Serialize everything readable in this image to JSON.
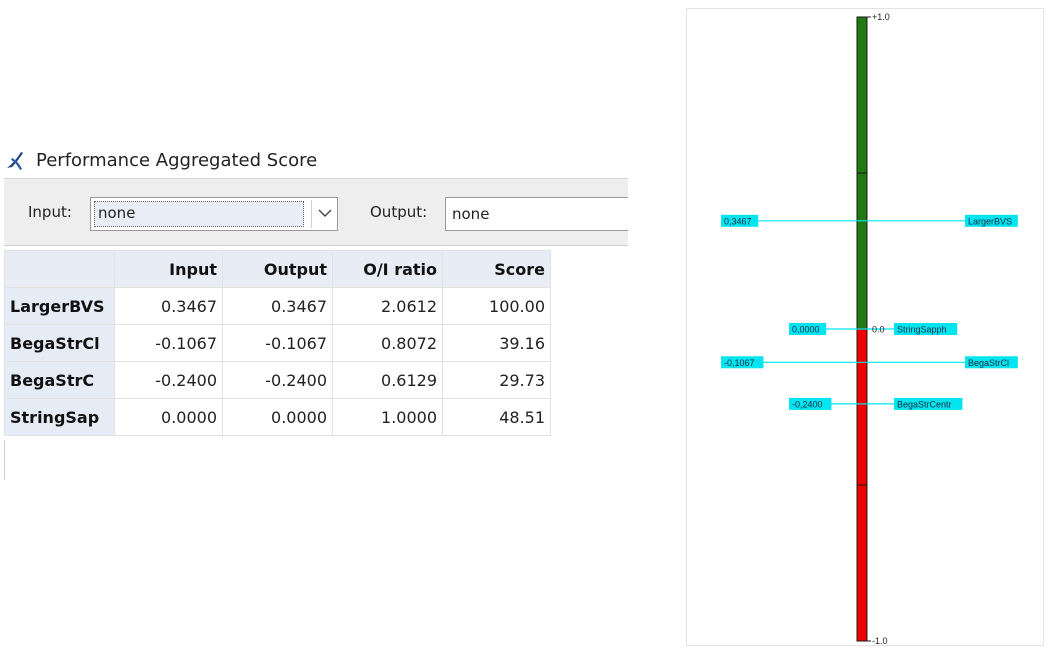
{
  "window": {
    "title": "Performance Aggregated Score",
    "icon": "app-logo-icon"
  },
  "toolbar": {
    "input_label": "Input:",
    "input_value": "none",
    "output_label": "Output:",
    "output_value": "none"
  },
  "table": {
    "columns": [
      "Input",
      "Output",
      "O/I ratio",
      "Score"
    ],
    "rows": [
      {
        "name": "LargerBVS",
        "input": "0.3467",
        "output": "0.3467",
        "ratio": "2.0612",
        "score": "100.00"
      },
      {
        "name": "BegaStrCl",
        "input": "-0.1067",
        "output": "-0.1067",
        "ratio": "0.8072",
        "score": "39.16"
      },
      {
        "name": "BegaStrC",
        "input": "-0.2400",
        "output": "-0.2400",
        "ratio": "0.6129",
        "score": "29.73"
      },
      {
        "name": "StringSap",
        "input": "0.0000",
        "output": "0.0000",
        "ratio": "1.0000",
        "score": "48.51"
      }
    ]
  },
  "chart_data": {
    "type": "bar",
    "ylim": [
      -1.0,
      1.0
    ],
    "tick_top": "+1.0",
    "tick_zero": "0.0",
    "tick_bottom": "-1.0",
    "colors": {
      "positive": "#1f7a12",
      "negative": "#ee0000",
      "marker": "#00e5f0"
    },
    "markers": [
      {
        "value": 0.3467,
        "value_label": "0,3467",
        "name": "LargerBVS",
        "side": "right"
      },
      {
        "value": 0.0,
        "value_label": "0,0000",
        "name": "StringSapph",
        "side": "near"
      },
      {
        "value": -0.1067,
        "value_label": "-0,1067",
        "name": "BegaStrCl",
        "side": "right"
      },
      {
        "value": -0.24,
        "value_label": "-0,2400",
        "name": "BegaStrCentr",
        "side": "near"
      }
    ]
  }
}
